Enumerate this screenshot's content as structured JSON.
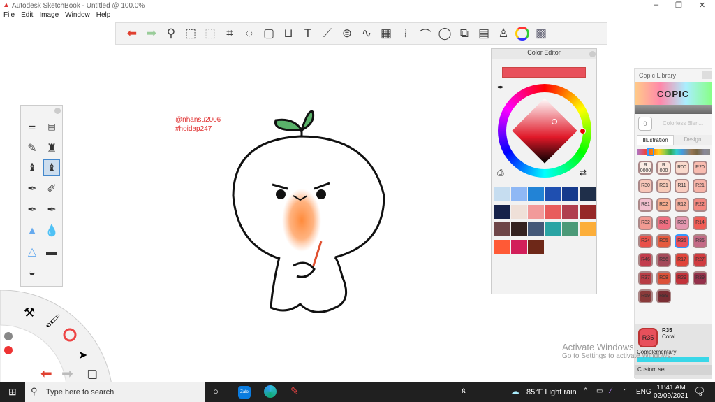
{
  "window": {
    "title": "Autodesk SketchBook - Untitled @ 100.0%",
    "minimize": "–",
    "maximize": "❐",
    "close": "✕"
  },
  "menu": [
    "File",
    "Edit",
    "Image",
    "Window",
    "Help"
  ],
  "toolbar_icons": [
    "undo-icon",
    "redo-icon",
    "zoom-icon",
    "select-icon",
    "crop-select-icon",
    "crop-icon",
    "lasso-icon",
    "distort-icon",
    "cylinder-icon",
    "text-icon",
    "ruler-icon",
    "ellipse-guide-icon",
    "curve-ruler-icon",
    "perspective-icon",
    "symmetry-icon",
    "stroke-icon",
    "circle-icon",
    "shape-icon",
    "copic-icon",
    "brush-library-icon",
    "color-wheel-icon",
    "layers-icon"
  ],
  "color_editor": {
    "title": "Color Editor",
    "current_color": "#e8505b",
    "swatches": [
      "#c6ddf0",
      "#8fb8f5",
      "#2283d6",
      "#1f4fb0",
      "#163a8c",
      "#1f2f4a",
      "#16224a",
      "#efe0d8",
      "#f29a9a",
      "#e85c5c",
      "#b03e4e",
      "#962828",
      "#6e4648",
      "#342220",
      "#445878",
      "#2aa4a4",
      "#4c9a78",
      "#fcae3a",
      "#ff5a36",
      "#d21f5a",
      "#6e2818"
    ]
  },
  "copic": {
    "title": "Copic Library",
    "logo": "COPIC",
    "colorless_label": "0",
    "colorless_name": "Colorless Blen...",
    "tabs": [
      "Illustration",
      "Design"
    ],
    "markers": [
      {
        "c": "R\n0000",
        "bg": "#fbeee6"
      },
      {
        "c": "R\n000",
        "bg": "#fbe6dc"
      },
      {
        "c": "R00",
        "bg": "#f9d9cc"
      },
      {
        "c": "R20",
        "bg": "#f8bcb0"
      },
      {
        "c": "R30",
        "bg": "#f7c6b8"
      },
      {
        "c": "R01",
        "bg": "#f7cbb8"
      },
      {
        "c": "R11",
        "bg": "#f9cdc0"
      },
      {
        "c": "R21",
        "bg": "#f7b4a8"
      },
      {
        "c": "R81",
        "bg": "#f2c0cf"
      },
      {
        "c": "R02",
        "bg": "#f5ac8e"
      },
      {
        "c": "R12",
        "bg": "#f4b0a0"
      },
      {
        "c": "R22",
        "bg": "#f38880"
      },
      {
        "c": "R32",
        "bg": "#f19a92"
      },
      {
        "c": "R43",
        "bg": "#ee6e80"
      },
      {
        "c": "R83",
        "bg": "#e498b0"
      },
      {
        "c": "R14",
        "bg": "#ef5d56"
      },
      {
        "c": "R24",
        "bg": "#e9514a"
      },
      {
        "c": "R05",
        "bg": "#e55a3e"
      },
      {
        "c": "R35",
        "bg": "#e8505b"
      },
      {
        "c": "R85",
        "bg": "#c46a86"
      },
      {
        "c": "R46",
        "bg": "#c23c4c"
      },
      {
        "c": "R56",
        "bg": "#a44a5a"
      },
      {
        "c": "R17",
        "bg": "#e0443a"
      },
      {
        "c": "R27",
        "bg": "#d03c40"
      },
      {
        "c": "R37",
        "bg": "#b83c44"
      },
      {
        "c": "R08",
        "bg": "#dc5038"
      },
      {
        "c": "R29",
        "bg": "#c2323a"
      },
      {
        "c": "R39",
        "bg": "#94304a"
      },
      {
        "c": "R59",
        "bg": "#8a3a3a"
      },
      {
        "c": "R89",
        "bg": "#7a2e34"
      }
    ],
    "selected": {
      "code": "R35",
      "name": "Coral",
      "color": "#e8505b"
    },
    "complementary": "Complementary",
    "complementary_color": "#39d7e8",
    "custom_set": "Custom set"
  },
  "watermark": [
    "@nhansu2006",
    "#hoidap247"
  ],
  "activate": {
    "title": "Activate Windows",
    "sub": "Go to Settings to activate Windows."
  },
  "taskbar": {
    "search_placeholder": "Type here to search",
    "weather": "85°F  Light rain",
    "lang": "ENG",
    "time": "11:41 AM",
    "date": "02/09/2021",
    "notifications": "3"
  }
}
